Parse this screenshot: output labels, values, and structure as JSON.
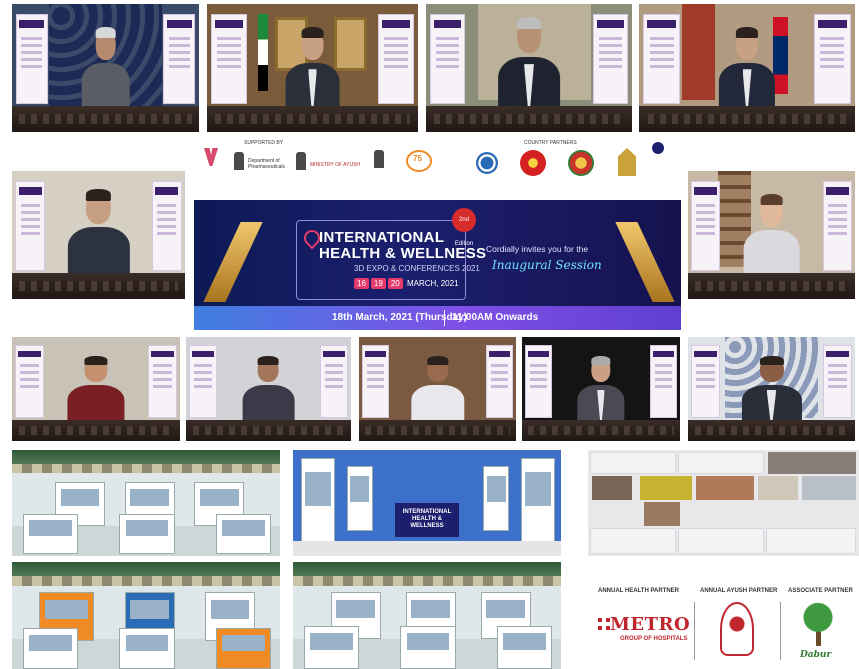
{
  "banner": {
    "title_line1": "INTERNATIONAL",
    "title_line2": "HEALTH & WELLNESS",
    "subtitle": "3D EXPO & CONFERENCES 2021",
    "dates": [
      "16",
      "19",
      "20"
    ],
    "dates_suffix": "MARCH, 2021",
    "edition": "2nd Edition",
    "invite_text": "Cordially invites you for the",
    "session": "Inaugural Session",
    "event_date": "18th March, 2021 (Thursday)",
    "event_time": "11:00AM Onwards"
  },
  "logos": {
    "supported_by": "SUPPORTED BY",
    "country_partners": "COUNTRY PARTNERS",
    "dept_pharma": "Department of Pharmaceuticals",
    "ministry_ayush": "MINISTRY OF AYUSH",
    "azadi": "75"
  },
  "expo_banner": {
    "line1": "INTERNATIONAL",
    "line2": "HEALTH & WELLNESS"
  },
  "partners": {
    "health_label": "ANNUAL HEALTH PARTNER",
    "ayush_label": "ANNUAL AYUSH PARTNER",
    "associate_label": "ASSOCIATE PARTNER",
    "metro": "METRO",
    "metro_sub": "GROUP OF HOSPITALS",
    "dabur": "Dabur"
  },
  "colors": {
    "banner_bg": "#1b1f6e",
    "accent_pink": "#e53a6b",
    "ribbon_gold": "#d9a441",
    "metro_red": "#c0262d",
    "dabur_green": "#2d7a2d"
  }
}
